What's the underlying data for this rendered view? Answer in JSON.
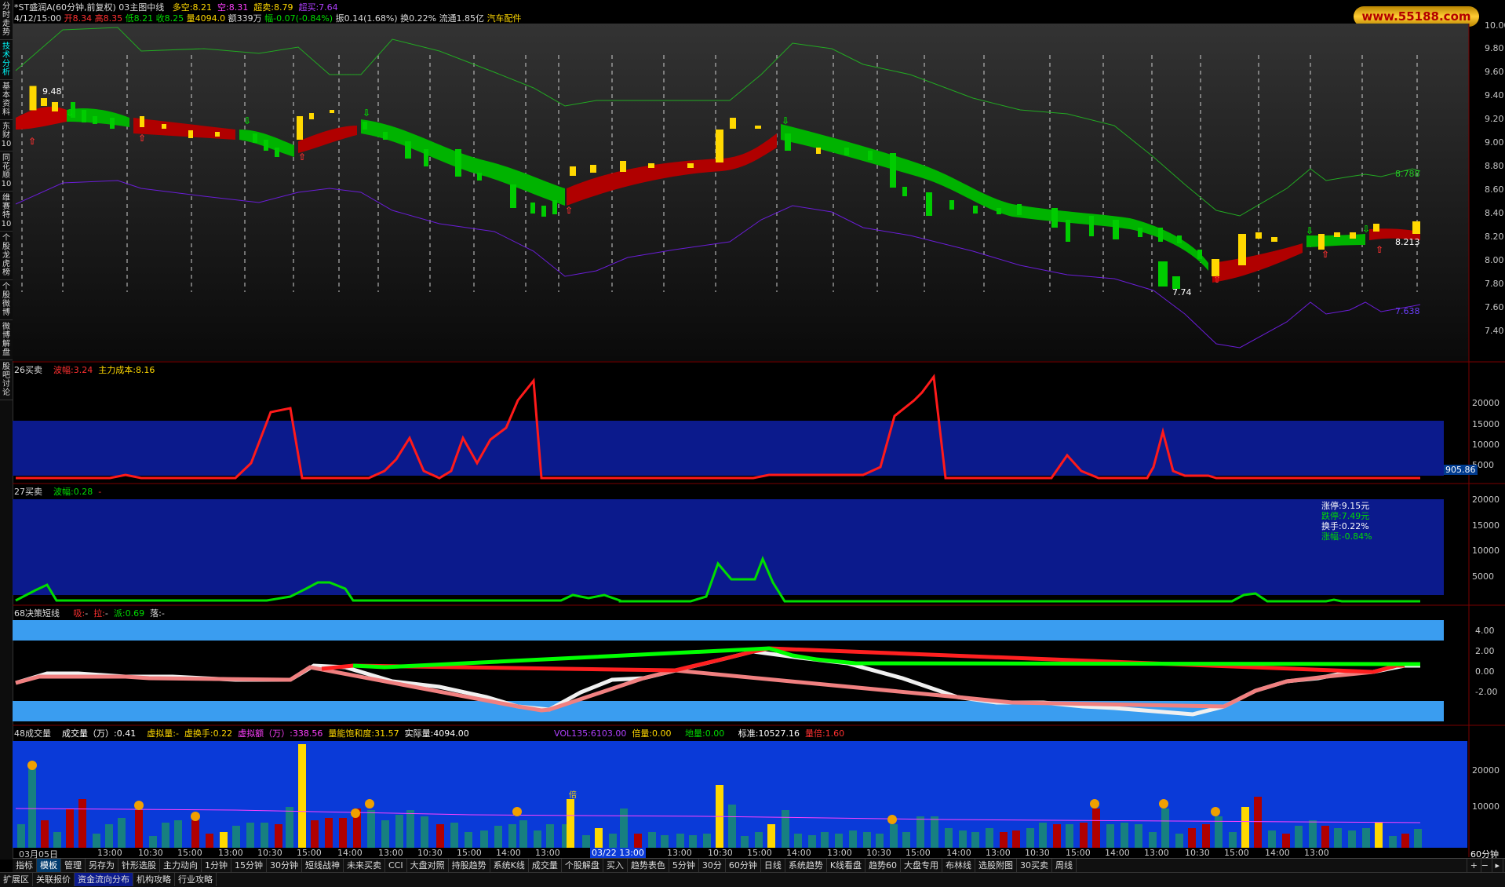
{
  "sidebar": [
    {
      "label": "分时走势",
      "active": false
    },
    {
      "label": "技术分析",
      "active": true
    },
    {
      "label": "基本资料",
      "active": false
    },
    {
      "label": "东财10",
      "active": false
    },
    {
      "label": "同花顺10",
      "active": false
    },
    {
      "label": "维赛特10",
      "active": false
    },
    {
      "label": "个股龙虎榜",
      "active": false
    },
    {
      "label": "个股微博",
      "active": false
    },
    {
      "label": "微博解盘",
      "active": false
    },
    {
      "label": "股吧讨论",
      "active": false
    }
  ],
  "header": {
    "title": "*ST盛润A(60分钟,前复权) 03主图中线",
    "duokong_label": "多空:",
    "duokong": "8.21",
    "kong_label": "空:",
    "kong": "8.31",
    "chaomai_label": "超卖:",
    "chaomai": "8.79",
    "chaomai2_label": "超买:",
    "chaomai2": "7.64",
    "date": "4/12/15:00",
    "open_label": "开",
    "open": "8.34",
    "high_label": "高",
    "high": "8.35",
    "low_label": "低",
    "low": "8.21",
    "close_label": "收",
    "close": "8.25",
    "vol_label": "量",
    "vol": "4094.0",
    "amount_label": "额",
    "amount": "339万",
    "change_label": "幅",
    "change": "-0.07(-0.84%)",
    "amplitude": "振0.14(1.68%)",
    "turnover": "换0.22%",
    "float": "流通1.85亿",
    "industry": "汽车配件"
  },
  "logo_text": "www.55188.com",
  "main_axis": [
    "10.00",
    "9.80",
    "9.60",
    "9.40",
    "9.20",
    "9.00",
    "8.80",
    "8.60",
    "8.40",
    "8.20",
    "8.00",
    "7.80",
    "7.60",
    "7.40"
  ],
  "main_annotations": {
    "high_mark": "9.48",
    "low_mark": "7.74",
    "upper_value": "8.788",
    "mid_value": "8.213",
    "lower_value": "7.638"
  },
  "panel26": {
    "name": "26买卖",
    "wave_label": "波幅:",
    "wave": "3.24",
    "cost_label": "主力成本:",
    "cost": "8.16",
    "axis": [
      "20000",
      "15000",
      "10000",
      "5000"
    ],
    "value_box": "905.86"
  },
  "panel27": {
    "name": "27买卖",
    "wave_label": "波幅:",
    "wave": "0.28",
    "dash": "-",
    "axis": [
      "20000",
      "15000",
      "10000",
      "5000"
    ],
    "info": {
      "up": "涨停:9.15元",
      "down": "跌停:7.49元",
      "turn": "换手:0.22%",
      "chg": "涨幅:-0.84%"
    }
  },
  "panel68": {
    "name": "68决策短线",
    "xi_label": "吸:",
    "xi": "-",
    "la_label": "拉:",
    "la": "-",
    "pai_label": "派:",
    "pai": "0.69",
    "luo_label": "落:",
    "luo": "-",
    "axis": [
      "4.00",
      "2.00",
      "0.00",
      "-2.00"
    ]
  },
  "panel48": {
    "name": "48成交量",
    "vol_label": "成交量（万）:",
    "vol": "0.41",
    "vxl_label": "虚拟量:",
    "vxl": "-",
    "vhs_label": "虚换手:",
    "vhs": "0.22",
    "vamt_label": "虚拟额（万）:",
    "vamt": "338.56",
    "bh_label": "量能饱和度:",
    "bh": "31.57",
    "sj_label": "实际量:",
    "sj": "4094.00",
    "vol135_label": "VOL135:",
    "vol135": "6103.00",
    "bl_label": "倍量:",
    "bl": "0.00",
    "dl_label": "地量:",
    "dl": "0.00",
    "bz_label": "标准:",
    "bz": "10527.16",
    "hl_label": "量倍:",
    "hl": "1.60",
    "axis": [
      "20000",
      "10000"
    ],
    "bei_label": "倍"
  },
  "time_axis": [
    "03月05日",
    "13:00",
    "10:30",
    "15:00",
    "13:00",
    "10:30",
    "15:00",
    "14:00",
    "13:00",
    "10:30",
    "15:00",
    "14:00",
    "13:00",
    "10:30",
    "03/22 13:00",
    "13:00",
    "10:30",
    "15:00",
    "14:00",
    "13:00",
    "10:30",
    "15:00",
    "14:00",
    "13:00",
    "10:30",
    "15:00",
    "14:00",
    "13:00",
    "10:30",
    "15:00",
    "14:00",
    "13:00"
  ],
  "period": "60分钟",
  "bottom_tabs": [
    "指标",
    "模板",
    "管理",
    "另存为",
    "针形选股",
    "主力动向",
    "1分钟",
    "15分钟",
    "30分钟",
    "短线战神",
    "未来买卖",
    "CCI",
    "大盘对照",
    "持股趋势",
    "系统K线",
    "成交量",
    "个股解盘",
    "买入",
    "趋势表色",
    "5分钟",
    "30分",
    "60分钟",
    "日线",
    "系统趋势",
    "K线看盘",
    "趋势60",
    "大盘专用",
    "布林线",
    "选股附图",
    "30买卖",
    "周线"
  ],
  "active_tab": "模板",
  "bottom_tabs2": [
    "扩展区",
    "关联报价",
    "资金流向分布",
    "机构攻略",
    "行业攻略"
  ],
  "colors": {
    "up": "#e00000",
    "down": "#00cc00",
    "yellow": "#ffd800",
    "cyan": "#00ffff",
    "blue_panel": "#0b1a8c",
    "light_blue": "#3a9df0"
  }
}
